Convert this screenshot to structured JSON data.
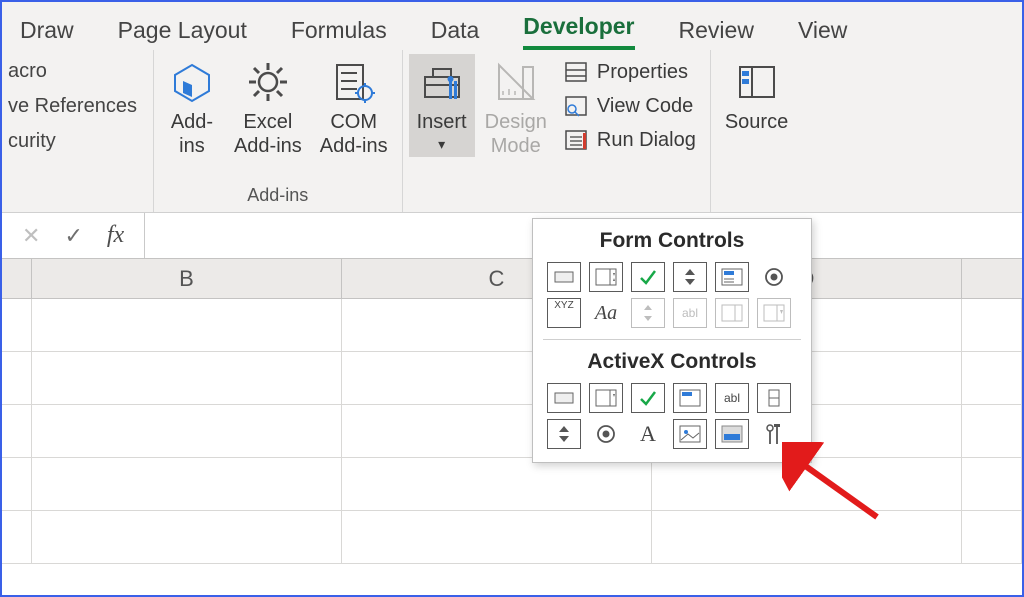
{
  "tabs": {
    "draw": "Draw",
    "page_layout": "Page Layout",
    "formulas": "Formulas",
    "data": "Data",
    "developer": "Developer",
    "review": "Review",
    "view": "View"
  },
  "left_partial": {
    "macro": "acro",
    "relative": "ve References",
    "security": "curity"
  },
  "addins_group": {
    "addins": {
      "l1": "Add-",
      "l2": "ins"
    },
    "excel": {
      "l1": "Excel",
      "l2": "Add-ins"
    },
    "com": {
      "l1": "COM",
      "l2": "Add-ins"
    },
    "label": "Add-ins"
  },
  "controls_group": {
    "insert": {
      "l1": "Insert"
    },
    "design": {
      "l1": "Design",
      "l2": "Mode"
    },
    "properties": "Properties",
    "view_code": "View Code",
    "run_dialog": "Run Dialog"
  },
  "xml_group": {
    "source": "Source"
  },
  "formula_bar": {
    "fx": "fx",
    "value": ""
  },
  "columns": {
    "b": "B",
    "c": "C",
    "d": "D"
  },
  "dropdown": {
    "form_title": "Form Controls",
    "ax_title": "ActiveX Controls",
    "labels": {
      "xyz": "XYZ",
      "aa": "Aa",
      "abl": "abl",
      "a": "A"
    }
  }
}
